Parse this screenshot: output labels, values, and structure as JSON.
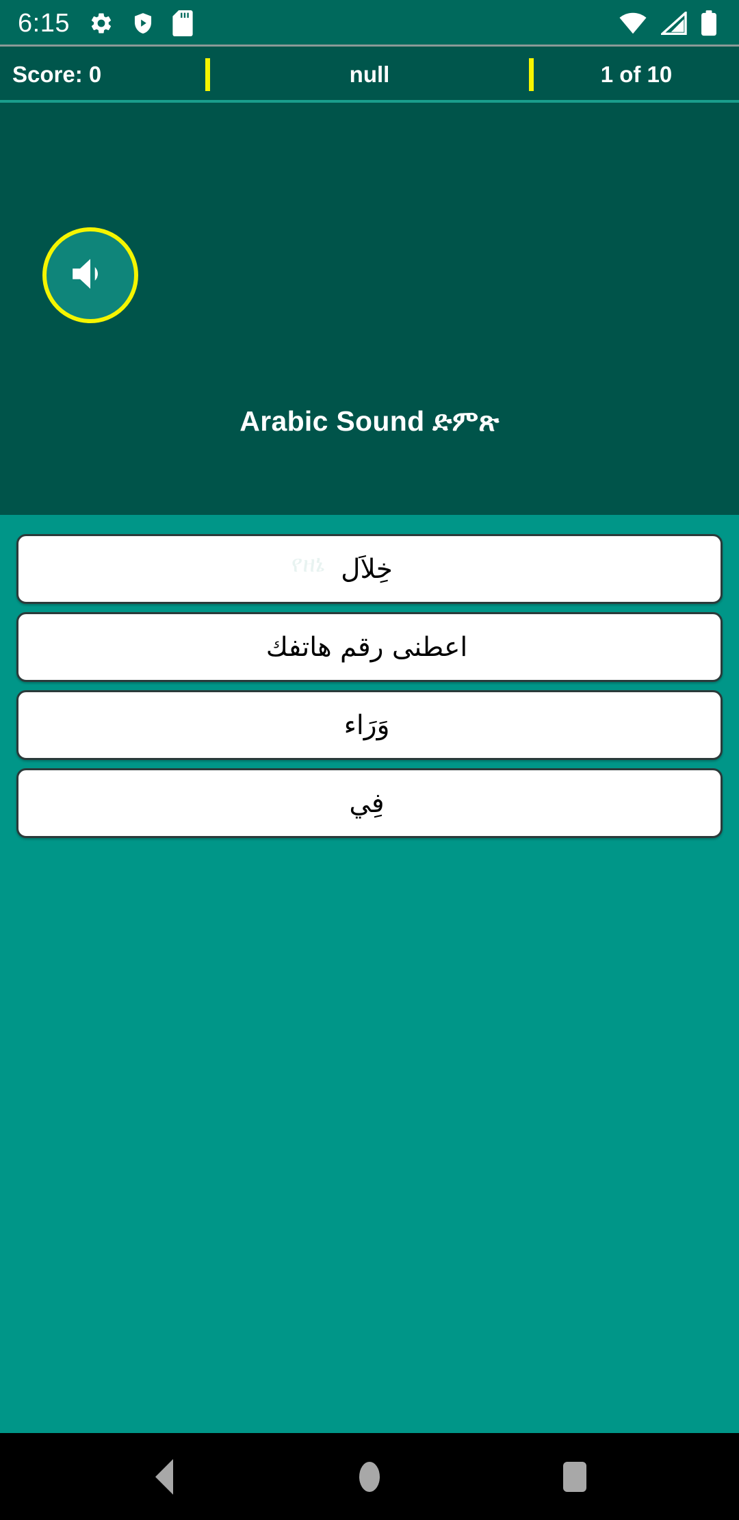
{
  "status_bar": {
    "clock": "6:15",
    "left_icons": [
      "gear-icon",
      "play-protect-icon",
      "sd-card-icon"
    ],
    "right_icons": [
      "wifi-icon",
      "cellular-signal-icon",
      "battery-icon"
    ],
    "background_color": "#00695C"
  },
  "score_bar": {
    "score_label": "Score: 0",
    "middle_label": "null",
    "progress_label": "1 of 10",
    "divider_color": "#F5F500",
    "background_color": "#00564C"
  },
  "hero": {
    "speaker_button": "speaker-icon",
    "speaker_border_color": "#F5F500",
    "title": "Arabic Sound ድምጽ",
    "subtitle": "የዘኔ",
    "background_color": "#00544A"
  },
  "options": {
    "background_color": "#009688",
    "items": [
      {
        "text": "خِلاَل"
      },
      {
        "text": "اعطنى رقم هاتفك"
      },
      {
        "text": "وَرَاء"
      },
      {
        "text": "فِي"
      }
    ]
  },
  "nav_bar": {
    "background_color": "#000000",
    "buttons": [
      "back-icon",
      "home-icon",
      "recents-icon"
    ]
  }
}
